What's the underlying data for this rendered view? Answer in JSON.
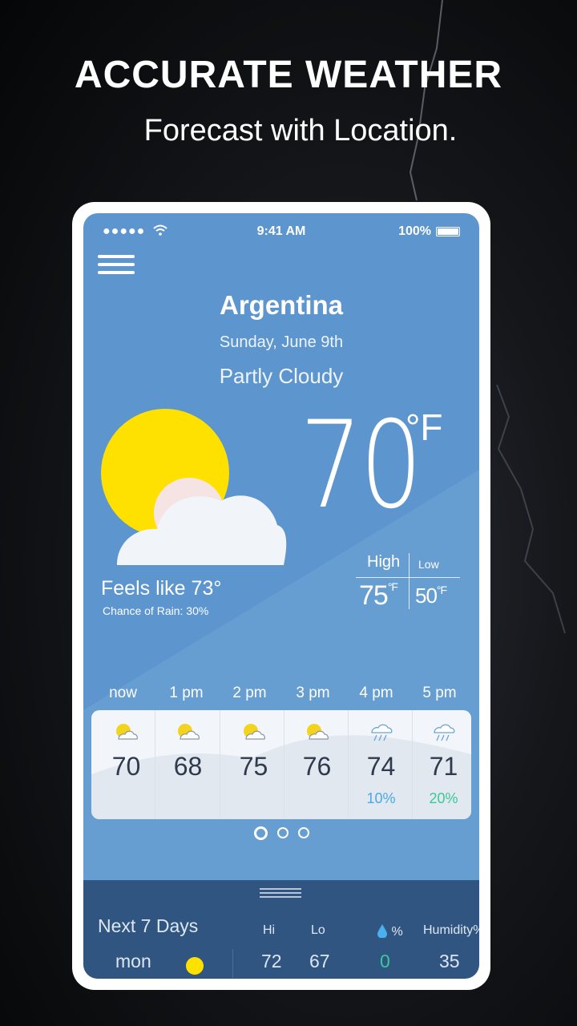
{
  "promo": {
    "title": "ACCURATE WEATHER",
    "subtitle": "Forecast with Location."
  },
  "status_bar": {
    "signal": "●●●●●",
    "time": "9:41 AM",
    "battery": "100%"
  },
  "location": {
    "city": "Argentina",
    "date": "Sunday, June 9th",
    "condition": "Partly Cloudy"
  },
  "current": {
    "temperature": "70",
    "unit": "°F",
    "feels_like": "Feels like 73°",
    "chance_of_rain": "Chance of Rain: 30%"
  },
  "high_low": {
    "high_label": "High",
    "low_label": "Low",
    "high_value": "75",
    "low_value": "50",
    "unit": "°F"
  },
  "hourly": [
    {
      "label": "now",
      "temp": "70",
      "icon": "partly-sunny-icon",
      "precip": ""
    },
    {
      "label": "1 pm",
      "temp": "68",
      "icon": "partly-sunny-icon",
      "precip": ""
    },
    {
      "label": "2 pm",
      "temp": "75",
      "icon": "partly-sunny-icon",
      "precip": ""
    },
    {
      "label": "3 pm",
      "temp": "76",
      "icon": "partly-sunny-icon",
      "precip": ""
    },
    {
      "label": "4 pm",
      "temp": "74",
      "icon": "thunder-rain-icon",
      "precip": "10%"
    },
    {
      "label": "5 pm",
      "temp": "71",
      "icon": "thunder-rain-icon",
      "precip": "20%"
    }
  ],
  "pager": {
    "pages": 3,
    "active": 0
  },
  "next_days": {
    "title": "Next 7 Days",
    "col_hi": "Hi",
    "col_lo": "Lo",
    "col_precip": "%",
    "col_humidity": "Humidity%",
    "rows": [
      {
        "day": "mon",
        "icon": "sun-icon",
        "hi": "72",
        "lo": "67",
        "precip": "0",
        "humidity": "35"
      }
    ]
  },
  "colors": {
    "sky": "#5d95cf",
    "sun": "#ffe100",
    "panel": "#2f5580",
    "precip_blue": "#4aa8e8",
    "precip_green": "#3cc89a"
  }
}
